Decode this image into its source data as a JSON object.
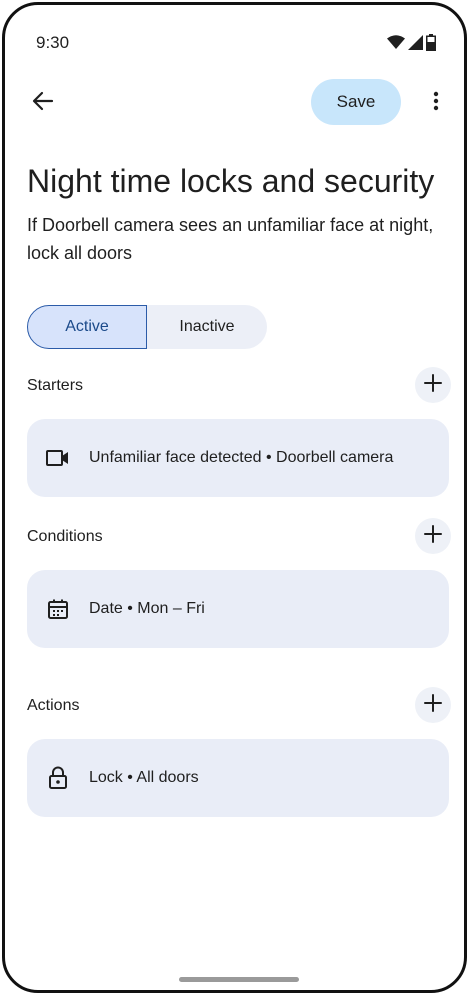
{
  "status_bar": {
    "time": "9:30",
    "icons": [
      "wifi-icon",
      "cellular-signal-icon",
      "battery-icon"
    ]
  },
  "app_bar": {
    "back_icon": "arrow-back-icon",
    "save_label": "Save",
    "more_icon": "more-vert-icon"
  },
  "page": {
    "title": "Night time locks and security",
    "description": "If Doorbell camera sees an unfamiliar face at night, lock all doors"
  },
  "toggle": {
    "active_label": "Active",
    "inactive_label": "Inactive",
    "selected": "Active"
  },
  "sections": {
    "starters": {
      "label": "Starters",
      "add_icon": "add-icon",
      "item": {
        "icon": "videocam-icon",
        "text": "Unfamiliar face detected • Doorbell camera"
      }
    },
    "conditions": {
      "label": "Conditions",
      "add_icon": "add-icon",
      "item": {
        "icon": "calendar-icon",
        "text": "Date • Mon – Fri"
      }
    },
    "actions": {
      "label": "Actions",
      "add_icon": "add-icon",
      "item": {
        "icon": "lock-icon",
        "text": "Lock • All doors"
      }
    }
  },
  "colors": {
    "save_button_bg": "#c8e6fb",
    "active_segment_bg": "#d7e3fb",
    "active_segment_border": "#2b5ba8",
    "card_bg": "#e9edf7"
  }
}
